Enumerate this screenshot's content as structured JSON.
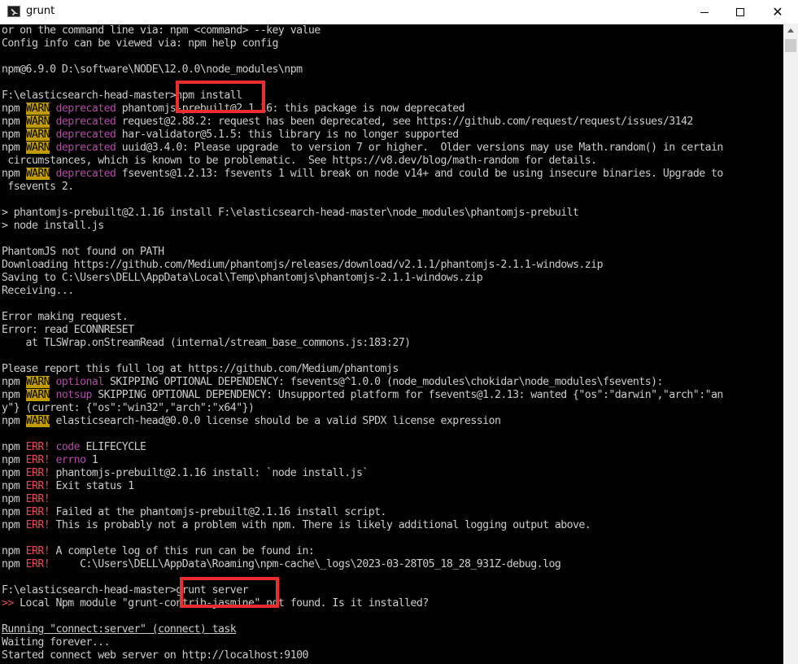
{
  "window": {
    "title": "grunt",
    "icon": "console-icon",
    "controls": {
      "minimize": "minimize-icon",
      "maximize": "maximize-icon",
      "close": "✕"
    }
  },
  "console": {
    "lines": [
      [
        {
          "t": "or on the command line via: npm <command> --key value"
        }
      ],
      [
        {
          "t": "Config info can be viewed via: npm help config"
        }
      ],
      [
        {
          "t": ""
        }
      ],
      [
        {
          "t": "npm@6.9.0 D:\\software\\NODE\\12.0.0\\node_modules\\npm"
        }
      ],
      [
        {
          "t": ""
        }
      ],
      [
        {
          "t": "F:\\elasticsearch-head-master>npm install"
        }
      ],
      [
        {
          "t": "npm "
        },
        {
          "t": "WARN",
          "c": "warn"
        },
        {
          "t": " "
        },
        {
          "t": "deprecated",
          "c": "mag"
        },
        {
          "t": " phantomjs-prebuilt@2.1.16: this package is now deprecated"
        }
      ],
      [
        {
          "t": "npm "
        },
        {
          "t": "WARN",
          "c": "warn"
        },
        {
          "t": " "
        },
        {
          "t": "deprecated",
          "c": "mag"
        },
        {
          "t": " request@2.88.2: request has been deprecated, see https://github.com/request/request/issues/3142"
        }
      ],
      [
        {
          "t": "npm "
        },
        {
          "t": "WARN",
          "c": "warn"
        },
        {
          "t": " "
        },
        {
          "t": "deprecated",
          "c": "mag"
        },
        {
          "t": " har-validator@5.1.5: this library is no longer supported"
        }
      ],
      [
        {
          "t": "npm "
        },
        {
          "t": "WARN",
          "c": "warn"
        },
        {
          "t": " "
        },
        {
          "t": "deprecated",
          "c": "mag"
        },
        {
          "t": " uuid@3.4.0: Please upgrade  to version 7 or higher.  Older versions may use Math.random() in certain"
        }
      ],
      [
        {
          "t": " circumstances, which is known to be problematic.  See https://v8.dev/blog/math-random for details."
        }
      ],
      [
        {
          "t": "npm "
        },
        {
          "t": "WARN",
          "c": "warn"
        },
        {
          "t": " "
        },
        {
          "t": "deprecated",
          "c": "mag"
        },
        {
          "t": " fsevents@1.2.13: fsevents 1 will break on node v14+ and could be using insecure binaries. Upgrade to"
        }
      ],
      [
        {
          "t": " fsevents 2."
        }
      ],
      [
        {
          "t": ""
        }
      ],
      [
        {
          "t": "> phantomjs-prebuilt@2.1.16 install F:\\elasticsearch-head-master\\node_modules\\phantomjs-prebuilt"
        }
      ],
      [
        {
          "t": "> node install.js"
        }
      ],
      [
        {
          "t": ""
        }
      ],
      [
        {
          "t": "PhantomJS not found on PATH"
        }
      ],
      [
        {
          "t": "Downloading https://github.com/Medium/phantomjs/releases/download/v2.1.1/phantomjs-2.1.1-windows.zip"
        }
      ],
      [
        {
          "t": "Saving to C:\\Users\\DELL\\AppData\\Local\\Temp\\phantomjs\\phantomjs-2.1.1-windows.zip"
        }
      ],
      [
        {
          "t": "Receiving..."
        }
      ],
      [
        {
          "t": ""
        }
      ],
      [
        {
          "t": "Error making request."
        }
      ],
      [
        {
          "t": "Error: read ECONNRESET"
        }
      ],
      [
        {
          "t": "    at TLSWrap.onStreamRead (internal/stream_base_commons.js:183:27)"
        }
      ],
      [
        {
          "t": ""
        }
      ],
      [
        {
          "t": "Please report this full log at https://github.com/Medium/phantomjs"
        }
      ],
      [
        {
          "t": "npm "
        },
        {
          "t": "WARN",
          "c": "warn"
        },
        {
          "t": " "
        },
        {
          "t": "optional",
          "c": "mag"
        },
        {
          "t": " SKIPPING OPTIONAL DEPENDENCY: fsevents@^1.0.0 (node_modules\\chokidar\\node_modules\\fsevents):"
        }
      ],
      [
        {
          "t": "npm "
        },
        {
          "t": "WARN",
          "c": "warn"
        },
        {
          "t": " "
        },
        {
          "t": "notsup",
          "c": "mag"
        },
        {
          "t": " SKIPPING OPTIONAL DEPENDENCY: Unsupported platform for fsevents@1.2.13: wanted {\"os\":\"darwin\",\"arch\":\"an"
        }
      ],
      [
        {
          "t": "y\"} (current: {\"os\":\"win32\",\"arch\":\"x64\"})"
        }
      ],
      [
        {
          "t": "npm "
        },
        {
          "t": "WARN",
          "c": "warn"
        },
        {
          "t": " elasticsearch-head@0.0.0 license should be a valid SPDX license expression"
        }
      ],
      [
        {
          "t": ""
        }
      ],
      [
        {
          "t": "npm "
        },
        {
          "t": "ERR!",
          "c": "red"
        },
        {
          "t": " "
        },
        {
          "t": "code",
          "c": "mag"
        },
        {
          "t": " ELIFECYCLE"
        }
      ],
      [
        {
          "t": "npm "
        },
        {
          "t": "ERR!",
          "c": "red"
        },
        {
          "t": " "
        },
        {
          "t": "errno",
          "c": "mag"
        },
        {
          "t": " 1"
        }
      ],
      [
        {
          "t": "npm "
        },
        {
          "t": "ERR!",
          "c": "red"
        },
        {
          "t": " phantomjs-prebuilt@2.1.16 install: `node install.js`"
        }
      ],
      [
        {
          "t": "npm "
        },
        {
          "t": "ERR!",
          "c": "red"
        },
        {
          "t": " Exit status 1"
        }
      ],
      [
        {
          "t": "npm "
        },
        {
          "t": "ERR!",
          "c": "red"
        }
      ],
      [
        {
          "t": "npm "
        },
        {
          "t": "ERR!",
          "c": "red"
        },
        {
          "t": " Failed at the phantomjs-prebuilt@2.1.16 install script."
        }
      ],
      [
        {
          "t": "npm "
        },
        {
          "t": "ERR!",
          "c": "red"
        },
        {
          "t": " This is probably not a problem with npm. There is likely additional logging output above."
        }
      ],
      [
        {
          "t": ""
        }
      ],
      [
        {
          "t": "npm "
        },
        {
          "t": "ERR!",
          "c": "red"
        },
        {
          "t": " A complete log of this run can be found in:"
        }
      ],
      [
        {
          "t": "npm "
        },
        {
          "t": "ERR!",
          "c": "red"
        },
        {
          "t": "     C:\\Users\\DELL\\AppData\\Roaming\\npm-cache\\_logs\\2023-03-28T05_18_28_931Z-debug.log"
        }
      ],
      [
        {
          "t": ""
        }
      ],
      [
        {
          "t": "F:\\elasticsearch-head-master>grunt server"
        }
      ],
      [
        {
          "t": ">>",
          "c": "red"
        },
        {
          "t": " Local Npm module \"grunt-contrib-jasmine\" not found. Is it installed?"
        }
      ],
      [
        {
          "t": ""
        }
      ],
      [
        {
          "t": "Running \"connect:server\" (connect) task",
          "c": "u"
        }
      ],
      [
        {
          "t": "Waiting forever..."
        }
      ],
      [
        {
          "t": "Started connect web server on http://localhost:9100"
        }
      ]
    ]
  },
  "colors": {
    "console_bg": "#000000",
    "console_text": "#cccccc",
    "warn_bg": "#c19c00",
    "keyword": "#b14aa8",
    "error": "#e74856",
    "highlight_box": "#ee2d2d"
  }
}
